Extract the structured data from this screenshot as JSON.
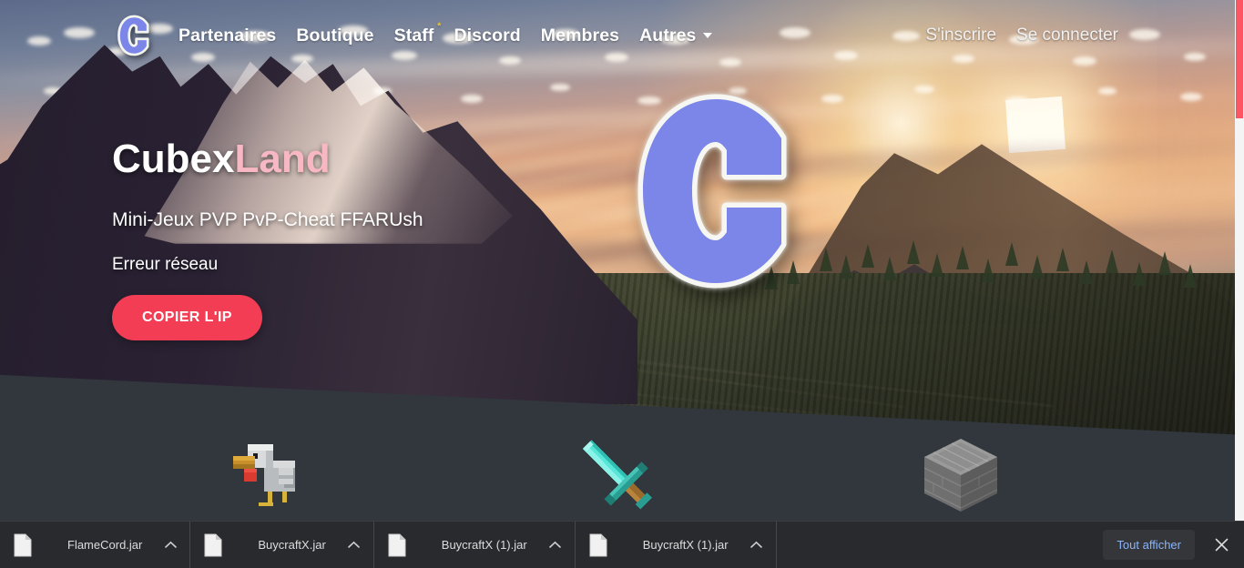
{
  "brand": {
    "logo_icon": "cubexland-c-logo-icon",
    "name_part_a": "Cubex",
    "name_part_b": "Land",
    "accent_pink": "#f7b8c4",
    "accent_red": "#f23d54",
    "logo_blue": "#7b86e8"
  },
  "navbar": {
    "links": [
      {
        "label": "Partenaires",
        "badge": ""
      },
      {
        "label": "Boutique",
        "badge": ""
      },
      {
        "label": "Staff",
        "badge": "*"
      },
      {
        "label": "Discord",
        "badge": ""
      },
      {
        "label": "Membres",
        "badge": ""
      },
      {
        "label": "Autres",
        "badge": "",
        "dropdown_icon": "chevron-down-icon"
      }
    ],
    "auth": [
      {
        "label": "S'inscrire"
      },
      {
        "label": "Se connecter"
      }
    ]
  },
  "hero": {
    "title_a": "Cubex",
    "title_b": "Land",
    "subtitle": "Mini-Jeux PVP PvP-Cheat FFARUsh",
    "status": "Erreur réseau",
    "copy_button": "COPIER L'IP",
    "center_logo_icon": "cubexland-c-logo-icon",
    "background": "minecraft-sunset-landscape"
  },
  "features": [
    {
      "icon": "minecraft-chicken-icon"
    },
    {
      "icon": "minecraft-diamond-sword-icon"
    },
    {
      "icon": "minecraft-stone-brick-block-icon"
    }
  ],
  "scrollbar": {
    "thumb_color": "#fc5665",
    "track_color": "#f4f4f4"
  },
  "download_shelf": {
    "items": [
      {
        "filename": "FlameCord.jar",
        "file_icon": "document-icon",
        "menu_icon": "chevron-up-icon"
      },
      {
        "filename": "BuycraftX.jar",
        "file_icon": "document-icon",
        "menu_icon": "chevron-up-icon"
      },
      {
        "filename": "BuycraftX (1).jar",
        "file_icon": "document-icon",
        "menu_icon": "chevron-up-icon"
      },
      {
        "filename": "BuycraftX (1).jar",
        "file_icon": "document-icon",
        "menu_icon": "chevron-up-icon"
      }
    ],
    "show_all_label": "Tout afficher",
    "close_icon": "close-icon",
    "link_color": "#8ab4f8"
  }
}
